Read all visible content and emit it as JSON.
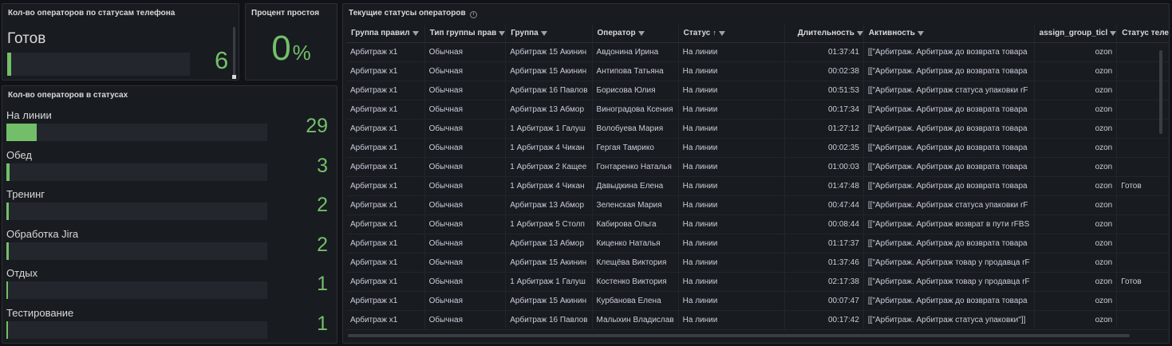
{
  "phone_panel": {
    "title": "Кол-во операторов по статусам телефона",
    "label": "Готов",
    "value": "6",
    "fill_fraction": 0.02
  },
  "idle_panel": {
    "title": "Процент простоя",
    "value": "0",
    "unit": "%"
  },
  "status_panel": {
    "title": "Кол-во операторов в статусах",
    "items": [
      {
        "label": "На линии",
        "value": "29",
        "fill_fraction": 0.115
      },
      {
        "label": "Обед",
        "value": "3",
        "fill_fraction": 0.012
      },
      {
        "label": "Тренинг",
        "value": "2",
        "fill_fraction": 0.008
      },
      {
        "label": "Обработка Jira",
        "value": "2",
        "fill_fraction": 0.008
      },
      {
        "label": "Отдых",
        "value": "1",
        "fill_fraction": 0.004
      },
      {
        "label": "Тестирование",
        "value": "1",
        "fill_fraction": 0.004
      }
    ]
  },
  "table_panel": {
    "title": "Текущие статусы операторов",
    "columns": [
      {
        "label": "Группа правил",
        "filter": true
      },
      {
        "label": "Тип группы прав",
        "filter": true
      },
      {
        "label": "Группа",
        "filter": true
      },
      {
        "label": "Оператор",
        "filter": true
      },
      {
        "label": "Статус",
        "filter": true,
        "sort": "↑"
      },
      {
        "label": "Длительность",
        "filter": true
      },
      {
        "label": "Активность",
        "filter": true
      },
      {
        "label": "assign_group_ticl",
        "filter": true
      },
      {
        "label": "Статус теле",
        "filter": false
      }
    ],
    "rows": [
      [
        "Арбитраж х1",
        "Обычная",
        "Арбитраж 15 Акинин",
        "Авдонина Ирина",
        "На линии",
        "01:37:41",
        "[[\"Арбитраж. Арбитраж до возврата товара",
        "ozon",
        ""
      ],
      [
        "Арбитраж х1",
        "Обычная",
        "Арбитраж 15 Акинин",
        "Антипова Татьяна",
        "На линии",
        "00:02:38",
        "[[\"Арбитраж. Арбитраж до возврата товара",
        "ozon",
        ""
      ],
      [
        "Арбитраж х1",
        "Обычная",
        "Арбитраж 16 Павлов",
        "Борисова Юлия",
        "На линии",
        "00:51:53",
        "[[\"Арбитраж. Арбитраж статуса упаковки rF",
        "ozon",
        ""
      ],
      [
        "Арбитраж х1",
        "Обычная",
        "Арбитраж 13 Абмор",
        "Виноградова Ксения",
        "На линии",
        "00:17:34",
        "[[\"Арбитраж. Арбитраж до возврата товара",
        "ozon",
        ""
      ],
      [
        "Арбитраж х1",
        "Обычная",
        "1 Арбитраж 1 Галуш",
        "Волобуева Мария",
        "На линии",
        "01:27:12",
        "[[\"Арбитраж. Арбитраж до возврата товара",
        "ozon",
        ""
      ],
      [
        "Арбитраж х1",
        "Обычная",
        "1 Арбитраж 4 Чикан",
        "Гергая Тамрико",
        "На линии",
        "00:02:35",
        "[[\"Арбитраж. Арбитраж до возврата товара",
        "ozon",
        ""
      ],
      [
        "Арбитраж х1",
        "Обычная",
        "1 Арбитраж 2 Кащее",
        "Гонтаренко Наталья",
        "На линии",
        "01:00:03",
        "[[\"Арбитраж. Арбитраж до возврата товара",
        "ozon",
        ""
      ],
      [
        "Арбитраж х1",
        "Обычная",
        "1 Арбитраж 4 Чикан",
        "Давыдкина Елена",
        "На линии",
        "01:47:48",
        "[[\"Арбитраж. Арбитраж до возврата товара",
        "ozon",
        "Готов"
      ],
      [
        "Арбитраж х1",
        "Обычная",
        "Арбитраж 13 Абмор",
        "Зеленская Мария",
        "На линии",
        "00:47:44",
        "[[\"Арбитраж. Арбитраж статуса упаковки rF",
        "ozon",
        ""
      ],
      [
        "Арбитраж х1",
        "Обычная",
        "1 Арбитраж 5 Столп",
        "Кабирова Ольга",
        "На линии",
        "00:08:44",
        "[[\"Арбитраж. Арбитраж возврат в пути rFBS",
        "ozon",
        ""
      ],
      [
        "Арбитраж х1",
        "Обычная",
        "Арбитраж 13 Абмор",
        "Киценко Наталья",
        "На линии",
        "01:17:37",
        "[[\"Арбитраж. Арбитраж до возврата товара",
        "ozon",
        ""
      ],
      [
        "Арбитраж х1",
        "Обычная",
        "Арбитраж 15 Акинин",
        "Клещёва Виктория",
        "На линии",
        "01:37:46",
        "[[\"Арбитраж. Арбитраж товар у продавца rF",
        "ozon",
        ""
      ],
      [
        "Арбитраж х1",
        "Обычная",
        "1 Арбитраж 1 Галуш",
        "Костенко Виктория",
        "На линии",
        "02:17:38",
        "[[\"Арбитраж. Арбитраж товар у продавца rF",
        "ozon",
        "Готов"
      ],
      [
        "Арбитраж х1",
        "Обычная",
        "Арбитраж 15 Акинин",
        "Курбанова Елена",
        "На линии",
        "00:07:47",
        "[[\"Арбитраж. Арбитраж до возврата товара",
        "ozon",
        ""
      ],
      [
        "Арбитраж х1",
        "Обычная",
        "Арбитраж 16 Павлов",
        "Малыхин Владислав",
        "На линии",
        "00:17:42",
        "[[\"Арбитраж. Арбитраж статуса упаковки\"]]",
        "ozon",
        ""
      ]
    ]
  }
}
